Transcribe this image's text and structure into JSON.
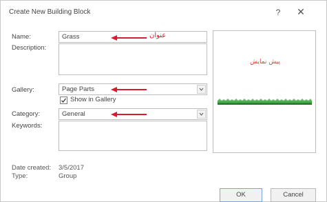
{
  "dialog": {
    "title": "Create New Building Block",
    "help_label": "?",
    "close_label": "✕"
  },
  "fields": {
    "name_label": "Name:",
    "name_value": "Grass",
    "name_note": "عنوان",
    "description_label": "Description:",
    "gallery_label": "Gallery:",
    "gallery_value": "Page Parts",
    "show_in_gallery_label": "Show in Gallery",
    "show_in_gallery_checked": true,
    "category_label": "Category:",
    "category_value": "General",
    "keywords_label": "Keywords:"
  },
  "preview": {
    "label": "پیش نمایش"
  },
  "info": {
    "date_created_label": "Date created:",
    "date_created_value": "3/5/2017",
    "type_label": "Type:",
    "type_value": "Group"
  },
  "buttons": {
    "ok_label": "OK",
    "cancel_label": "Cancel"
  },
  "colors": {
    "annotation_red": "#d81b2e",
    "preview_text_red": "#e53935",
    "grass_green": "#4caf50",
    "ok_border_blue": "#7aa7d8"
  }
}
